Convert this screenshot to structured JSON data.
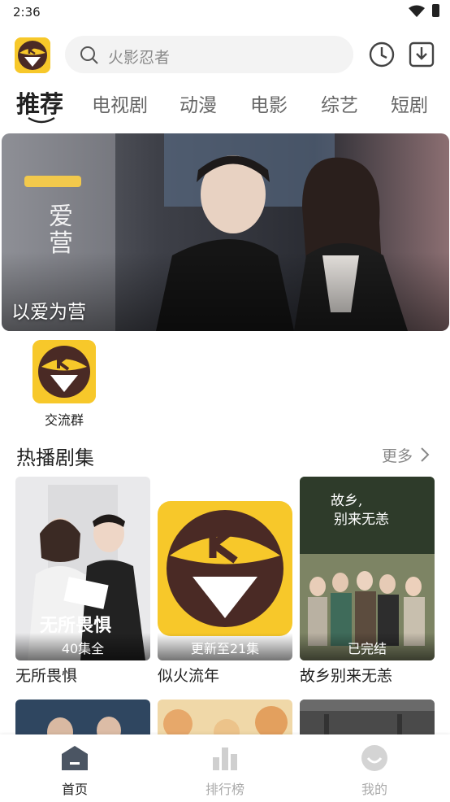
{
  "status_bar": {
    "time": "2:36"
  },
  "search": {
    "placeholder": "火影忍者"
  },
  "tabs": [
    {
      "label": "推荐",
      "active": true
    },
    {
      "label": "电视剧"
    },
    {
      "label": "动漫"
    },
    {
      "label": "电影"
    },
    {
      "label": "综艺"
    },
    {
      "label": "短剧"
    }
  ],
  "banner": {
    "title": "以爱为营"
  },
  "group": {
    "label": "交流群"
  },
  "hot_section": {
    "title": "热播剧集",
    "more": "更多"
  },
  "cards": [
    {
      "title": "无所畏惧",
      "badge": "40集全"
    },
    {
      "title": "似火流年",
      "badge": "更新至21集"
    },
    {
      "title": "故乡别来无恙",
      "badge": "已完结"
    }
  ],
  "bottom_nav": [
    {
      "label": "首页",
      "active": true
    },
    {
      "label": "排行榜"
    },
    {
      "label": "我的"
    }
  ],
  "colors": {
    "brand_yellow": "#f7c82a",
    "brand_brown": "#4a2a25"
  }
}
